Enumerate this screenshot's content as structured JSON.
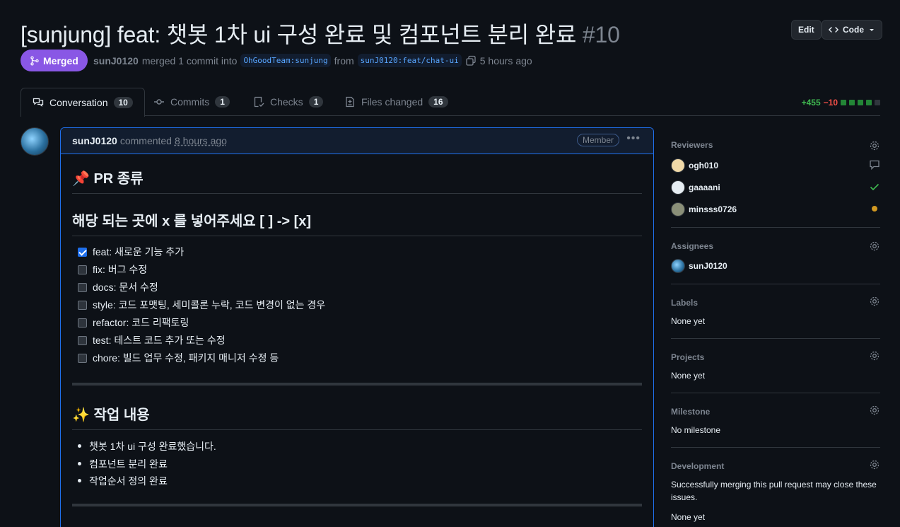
{
  "pr": {
    "title": "[sunjung] feat: 챗봇 1차 ui 구성 완료 및 컴포넌트 분리 완료",
    "number": "#10",
    "state": "Merged",
    "author": "sunJ0120",
    "action_text": "merged 1 commit into",
    "base_branch": "OhGoodTeam:sunjung",
    "from_text": "from",
    "head_branch": "sunJ0120:feat/chat-ui",
    "time_ago": "5 hours ago"
  },
  "header_buttons": {
    "edit": "Edit",
    "code": "Code"
  },
  "tabs": [
    {
      "label": "Conversation",
      "count": "10"
    },
    {
      "label": "Commits",
      "count": "1"
    },
    {
      "label": "Checks",
      "count": "1"
    },
    {
      "label": "Files changed",
      "count": "16"
    }
  ],
  "diffstat": {
    "additions": "+455",
    "deletions": "−10"
  },
  "comment": {
    "author": "sunJ0120",
    "verb": "commented",
    "time": "8 hours ago",
    "badge": "Member",
    "heading1": "📌 PR 종류",
    "heading2": "해당 되는 곳에 x 를 넣어주세요 [ ] -> [x]",
    "tasks": [
      {
        "label": "feat: 새로운 기능 추가",
        "checked": true
      },
      {
        "label": "fix: 버그 수정",
        "checked": false
      },
      {
        "label": "docs: 문서 수정",
        "checked": false
      },
      {
        "label": "style: 코드 포맷팅, 세미콜론 누락, 코드 변경이 없는 경우",
        "checked": false
      },
      {
        "label": "refactor: 코드 리팩토링",
        "checked": false
      },
      {
        "label": "test: 테스트 코드 추가 또는 수정",
        "checked": false
      },
      {
        "label": "chore: 빌드 업무 수정, 패키지 매니저 수정 등",
        "checked": false
      }
    ],
    "heading3": "✨ 작업 내용",
    "work_items": [
      "챗봇 1차 ui 구성 완료했습니다.",
      "컴포넌트 분리 완료",
      "작업순서 정의 완료"
    ]
  },
  "sidebar": {
    "reviewers_title": "Reviewers",
    "reviewers": [
      {
        "name": "ogh010",
        "status": "comment"
      },
      {
        "name": "gaaaani",
        "status": "approved"
      },
      {
        "name": "minsss0726",
        "status": "pending"
      }
    ],
    "assignees_title": "Assignees",
    "assignee": "sunJ0120",
    "labels_title": "Labels",
    "labels_value": "None yet",
    "projects_title": "Projects",
    "projects_value": "None yet",
    "milestone_title": "Milestone",
    "milestone_value": "No milestone",
    "development_title": "Development",
    "development_text": "Successfully merging this pull request may close these issues.",
    "development_value": "None yet"
  }
}
